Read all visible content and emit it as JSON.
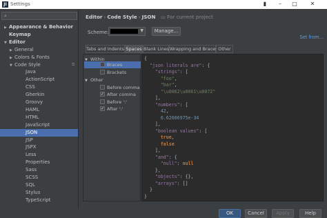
{
  "window": {
    "title": "Settings",
    "app_icon": "JI"
  },
  "tree": {
    "items": [
      {
        "label": "Appearance & Behavior",
        "arrow": "▶",
        "bold": true
      },
      {
        "label": "Keymap",
        "arrow": "",
        "bold": true
      },
      {
        "label": "Editor",
        "arrow": "▼",
        "bold": true
      },
      {
        "label": "General",
        "arrow": "▶",
        "bold": false
      },
      {
        "label": "Colors & Fonts",
        "arrow": "▶",
        "bold": false
      },
      {
        "label": "Code Style",
        "arrow": "▼",
        "bold": false
      },
      {
        "label": "Java",
        "arrow": "",
        "bold": false
      },
      {
        "label": "ActionScript",
        "arrow": "",
        "bold": false
      },
      {
        "label": "CSS",
        "arrow": "",
        "bold": false
      },
      {
        "label": "Gherkin",
        "arrow": "",
        "bold": false
      },
      {
        "label": "Groovy",
        "arrow": "",
        "bold": false
      },
      {
        "label": "HAML",
        "arrow": "",
        "bold": false
      },
      {
        "label": "HTML",
        "arrow": "",
        "bold": false
      },
      {
        "label": "JavaScript",
        "arrow": "",
        "bold": false
      },
      {
        "label": "JSON",
        "arrow": "",
        "bold": false
      },
      {
        "label": "JSP",
        "arrow": "",
        "bold": false
      },
      {
        "label": "JSPX",
        "arrow": "",
        "bold": false
      },
      {
        "label": "Less",
        "arrow": "",
        "bold": false
      },
      {
        "label": "Properties",
        "arrow": "",
        "bold": false
      },
      {
        "label": "Sass",
        "arrow": "",
        "bold": false
      },
      {
        "label": "SCSS",
        "arrow": "",
        "bold": false
      },
      {
        "label": "SQL",
        "arrow": "",
        "bold": false
      },
      {
        "label": "Stylus",
        "arrow": "",
        "bold": false
      },
      {
        "label": "TypeScript",
        "arrow": "",
        "bold": false
      }
    ],
    "selected": "JSON"
  },
  "breadcrumb": {
    "part1": "Editor",
    "sep": "›",
    "part2": "Code Style",
    "part3": "JSON",
    "project": "For current project"
  },
  "scheme": {
    "label": "Scheme:",
    "manage_label": "Manage...",
    "set_from": "Set from..."
  },
  "tabs": [
    "Tabs and Indents",
    "Spaces",
    "Blank Lines",
    "Wrapping and Braces",
    "Other"
  ],
  "active_tab": "Spaces",
  "options": {
    "within_group": "Within",
    "braces": "Braces",
    "brackets": "Brackets",
    "other_group": "Other",
    "before_comma": "Before comma",
    "after_comma": "After comma",
    "before_colon": "Before ':'",
    "after_colon": "After ':'",
    "checked": {
      "braces": false,
      "brackets": false,
      "before_comma": false,
      "after_comma": true,
      "before_colon": false,
      "after_colon": true
    }
  },
  "code": [
    "{",
    "  \"json literals are\": {",
    "    \"strings\": [",
    "      \"foo\",",
    "      \"bar\",",
    "      \"\\u0062\\u0061\\u0072\"",
    "    ],",
    "    \"numbers\": [",
    "      42,",
    "      6.62606975e-34",
    "    ],",
    "    \"boolean values\": [",
    "      true,",
    "      false",
    "    ],",
    "    \"and\": {",
    "      \"null\": null",
    "    },",
    "    \"objects\": {},",
    "    \"arrays\": []",
    "  }",
    "}"
  ],
  "buttons": {
    "ok": "OK",
    "cancel": "Cancel",
    "apply": "Apply",
    "help": "Help"
  },
  "colors": {
    "selection": "#4b6eaf",
    "key": "#9876aa",
    "string": "#6a8759",
    "number": "#6897bb",
    "keyword": "#cc7832"
  }
}
